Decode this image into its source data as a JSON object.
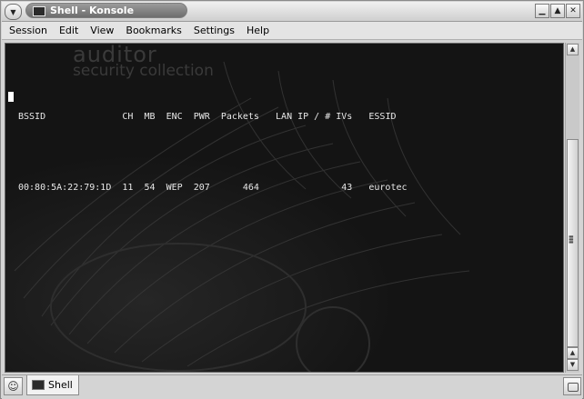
{
  "window": {
    "title": "Shell - Konsole",
    "controls": [
      "minimize-icon",
      "maximize-icon",
      "close-icon"
    ]
  },
  "menu": {
    "items": [
      "Session",
      "Edit",
      "View",
      "Bookmarks",
      "Settings",
      "Help"
    ]
  },
  "terminal": {
    "watermark": [
      "auditor",
      "security collection"
    ],
    "header": {
      "bssid": "BSSID",
      "ch": "CH",
      "mb": "MB",
      "enc": "ENC",
      "pwr": "PWR",
      "packets": "Packets",
      "lan_ip_ivs": "LAN IP / # IVs",
      "essid": "ESSID"
    },
    "rows": [
      {
        "bssid": "00:80:5A:22:79:1D",
        "ch": "11",
        "mb": "54",
        "enc": "WEP",
        "pwr": "207",
        "packets": "464",
        "ivs": "43",
        "essid": "eurotec"
      }
    ]
  },
  "tabs": [
    {
      "label": "Shell",
      "icon": "terminal-icon",
      "active": true
    }
  ],
  "colors": {
    "terminal_bg": "#141414",
    "terminal_text": "#e8e8e8",
    "title_pill": "#7d7d7d"
  }
}
